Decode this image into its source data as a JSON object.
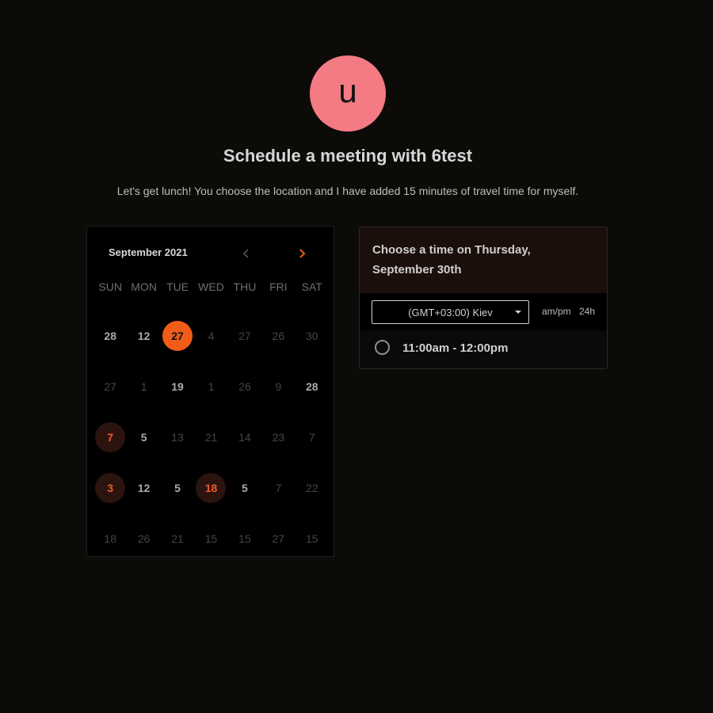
{
  "avatar": {
    "initial": "u",
    "color": "#f47b83"
  },
  "title": "Schedule a meeting with 6test",
  "subtitle": "Let's get lunch! You choose the location and I have added 15 minutes of travel time for myself.",
  "calendar": {
    "month_label": "September 2021",
    "prev_icon": "chevron-left-icon",
    "next_icon": "chevron-right-icon",
    "weekdays": [
      "SUN",
      "MON",
      "TUE",
      "WED",
      "THU",
      "FRI",
      "SAT"
    ],
    "days": [
      {
        "label": "28",
        "state": "avail"
      },
      {
        "label": "12",
        "state": "avail"
      },
      {
        "label": "27",
        "state": "selected"
      },
      {
        "label": "4",
        "state": "faint"
      },
      {
        "label": "27",
        "state": "faint"
      },
      {
        "label": "26",
        "state": "faint"
      },
      {
        "label": "30",
        "state": "faint"
      },
      {
        "label": "27",
        "state": "faint"
      },
      {
        "label": "1",
        "state": "faint"
      },
      {
        "label": "19",
        "state": "avail"
      },
      {
        "label": "1",
        "state": "faint"
      },
      {
        "label": "26",
        "state": "faint"
      },
      {
        "label": "9",
        "state": "faint"
      },
      {
        "label": "28",
        "state": "avail"
      },
      {
        "label": "7",
        "state": "highlight"
      },
      {
        "label": "5",
        "state": "avail"
      },
      {
        "label": "13",
        "state": "faint"
      },
      {
        "label": "21",
        "state": "faint"
      },
      {
        "label": "14",
        "state": "faint"
      },
      {
        "label": "23",
        "state": "faint"
      },
      {
        "label": "7",
        "state": "faint"
      },
      {
        "label": "3",
        "state": "highlight"
      },
      {
        "label": "12",
        "state": "avail"
      },
      {
        "label": "5",
        "state": "avail"
      },
      {
        "label": "18",
        "state": "highlight"
      },
      {
        "label": "5",
        "state": "avail"
      },
      {
        "label": "7",
        "state": "faint"
      },
      {
        "label": "22",
        "state": "faint"
      },
      {
        "label": "18",
        "state": "faint"
      },
      {
        "label": "26",
        "state": "faint"
      },
      {
        "label": "21",
        "state": "faint"
      },
      {
        "label": "15",
        "state": "faint"
      },
      {
        "label": "15",
        "state": "faint"
      },
      {
        "label": "27",
        "state": "faint"
      },
      {
        "label": "15",
        "state": "faint"
      }
    ]
  },
  "time_panel": {
    "heading": "Choose a time on Thursday, September 30th",
    "timezone": "(GMT+03:00) Kiev",
    "format_ampm": "am/pm",
    "format_24h": "24h",
    "slots": [
      {
        "label": "11:00am - 12:00pm"
      }
    ]
  },
  "colors": {
    "accent": "#f25c19",
    "highlight_bg": "#2b1410",
    "highlight_text": "#f0592a",
    "background": "#0d0b08"
  }
}
